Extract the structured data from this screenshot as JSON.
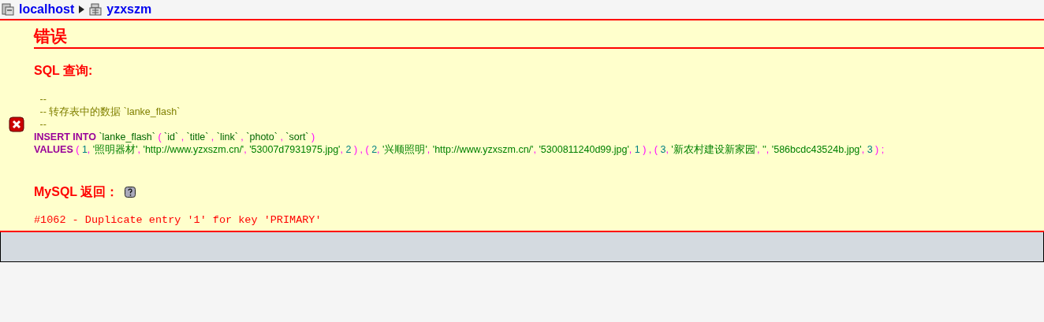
{
  "breadcrumb": {
    "server": "localhost",
    "database": "yzxszm"
  },
  "error": {
    "title": "错误",
    "query_label": "SQL 查询:",
    "sql_lines": [
      {
        "tokens": [
          {
            "kind": "comment",
            "text": " --"
          }
        ]
      },
      {
        "tokens": [
          {
            "kind": "comment",
            "text": " -- 转存表中的数据 `lanke_flash`"
          }
        ]
      },
      {
        "tokens": [
          {
            "kind": "comment",
            "text": " --"
          }
        ]
      },
      {
        "tokens": [
          {
            "kind": "keyword",
            "text": "INSERT INTO "
          },
          {
            "kind": "name",
            "text": "`lanke_flash` "
          },
          {
            "kind": "punct",
            "text": "( "
          },
          {
            "kind": "name",
            "text": "`id` "
          },
          {
            "kind": "punct",
            "text": ", "
          },
          {
            "kind": "name",
            "text": "`title` "
          },
          {
            "kind": "punct",
            "text": ", "
          },
          {
            "kind": "name",
            "text": "`link` "
          },
          {
            "kind": "punct",
            "text": ", "
          },
          {
            "kind": "name",
            "text": "`photo` "
          },
          {
            "kind": "punct",
            "text": ", "
          },
          {
            "kind": "name",
            "text": "`sort` "
          },
          {
            "kind": "punct",
            "text": ")"
          }
        ]
      },
      {
        "tokens": [
          {
            "kind": "keyword",
            "text": "VALUES "
          },
          {
            "kind": "punct",
            "text": "( "
          },
          {
            "kind": "number",
            "text": "1"
          },
          {
            "kind": "punct",
            "text": ", "
          },
          {
            "kind": "string",
            "text": "'照明器材'"
          },
          {
            "kind": "punct",
            "text": ", "
          },
          {
            "kind": "string",
            "text": "'http://www.yzxszm.cn/'"
          },
          {
            "kind": "punct",
            "text": ", "
          },
          {
            "kind": "string",
            "text": "'53007d7931975.jpg'"
          },
          {
            "kind": "punct",
            "text": ", "
          },
          {
            "kind": "number",
            "text": "2 "
          },
          {
            "kind": "punct",
            "text": ") , ( "
          },
          {
            "kind": "number",
            "text": "2"
          },
          {
            "kind": "punct",
            "text": ", "
          },
          {
            "kind": "string",
            "text": "'兴顺照明'"
          },
          {
            "kind": "punct",
            "text": ", "
          },
          {
            "kind": "string",
            "text": "'http://www.yzxszm.cn/'"
          },
          {
            "kind": "punct",
            "text": ", "
          },
          {
            "kind": "string",
            "text": "'5300811240d99.jpg'"
          },
          {
            "kind": "punct",
            "text": ", "
          },
          {
            "kind": "number",
            "text": "1 "
          },
          {
            "kind": "punct",
            "text": ") , ( "
          },
          {
            "kind": "number",
            "text": "3"
          },
          {
            "kind": "punct",
            "text": ", "
          },
          {
            "kind": "string",
            "text": "'新农村建设新家园'"
          },
          {
            "kind": "punct",
            "text": ", "
          },
          {
            "kind": "string",
            "text": "''"
          },
          {
            "kind": "punct",
            "text": ", "
          },
          {
            "kind": "string",
            "text": "'586bcdc43524b.jpg'"
          },
          {
            "kind": "punct",
            "text": ", "
          },
          {
            "kind": "number",
            "text": "3 "
          },
          {
            "kind": "punct",
            "text": ") ;"
          }
        ]
      }
    ],
    "return_label": "MySQL 返回：",
    "message": "#1062 - Duplicate entry '1' for key 'PRIMARY'"
  }
}
